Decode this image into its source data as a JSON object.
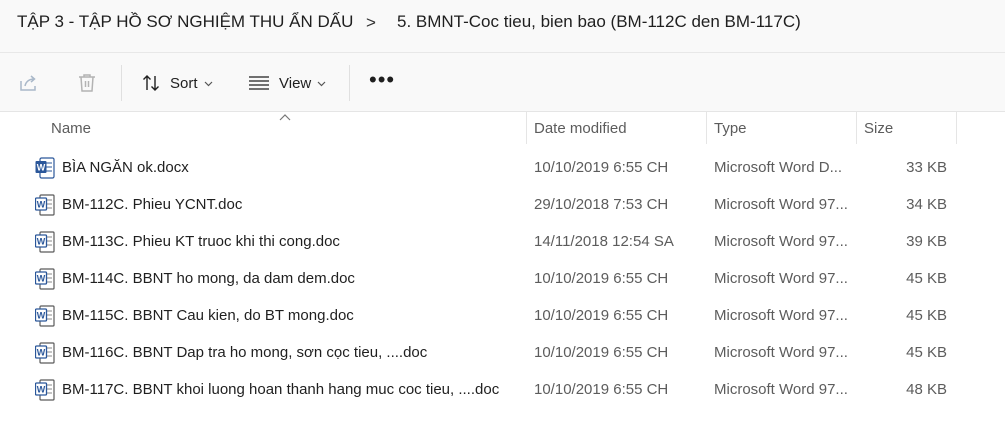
{
  "breadcrumb": {
    "items": [
      "TẬP 3 - TẬP HỒ SƠ NGHIỆM THU ẨN DẤU",
      "5. BMNT-Coc tieu, bien bao (BM-112C den BM-117C)"
    ],
    "separator": ">"
  },
  "toolbar": {
    "share_icon": "share-icon",
    "delete_icon": "trash-icon",
    "sort_label": "Sort",
    "view_label": "View",
    "more_label": "•••"
  },
  "columns": {
    "name": "Name",
    "date": "Date modified",
    "type": "Type",
    "size": "Size"
  },
  "files": [
    {
      "name": "BÌA NGĂN ok.docx",
      "date": "10/10/2019 6:55 CH",
      "type": "Microsoft Word D...",
      "size": "33 KB",
      "icon": "word-docx-icon"
    },
    {
      "name": "BM-112C. Phieu YCNT.doc",
      "date": "29/10/2018 7:53 CH",
      "type": "Microsoft Word 97...",
      "size": "34 KB",
      "icon": "word-doc-icon"
    },
    {
      "name": "BM-113C. Phieu KT truoc khi thi cong.doc",
      "date": "14/11/2018 12:54 SA",
      "type": "Microsoft Word 97...",
      "size": "39 KB",
      "icon": "word-doc-icon"
    },
    {
      "name": "BM-114C. BBNT ho mong, da dam dem.doc",
      "date": "10/10/2019 6:55 CH",
      "type": "Microsoft Word 97...",
      "size": "45 KB",
      "icon": "word-doc-icon"
    },
    {
      "name": "BM-115C. BBNT Cau kien, do BT mong.doc",
      "date": "10/10/2019 6:55 CH",
      "type": "Microsoft Word 97...",
      "size": "45 KB",
      "icon": "word-doc-icon"
    },
    {
      "name": "BM-116C. BBNT Dap tra ho mong, sơn cọc tieu, ....doc",
      "date": "10/10/2019 6:55 CH",
      "type": "Microsoft Word 97...",
      "size": "45 KB",
      "icon": "word-doc-icon"
    },
    {
      "name": "BM-117C. BBNT khoi luong hoan thanh hang muc coc tieu, ....doc",
      "date": "10/10/2019 6:55 CH",
      "type": "Microsoft Word 97...",
      "size": "48 KB",
      "icon": "word-doc-icon"
    }
  ]
}
